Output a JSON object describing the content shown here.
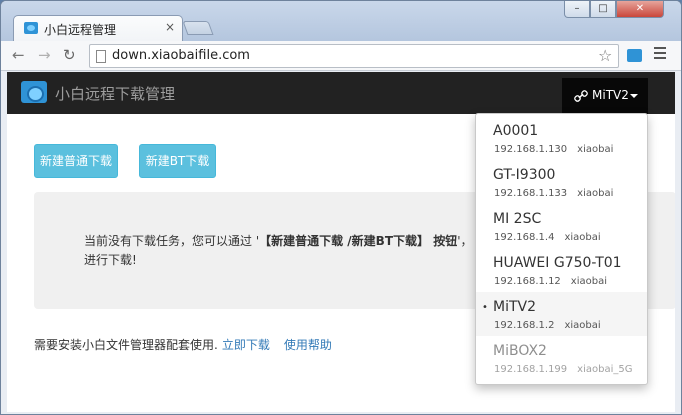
{
  "browser": {
    "tab_title": "小白远程管理",
    "tab_close": "×",
    "url": "down.xiaobaifile.com",
    "window_controls": {
      "minimize": "–",
      "maximize": "□",
      "close": "✕"
    }
  },
  "app": {
    "brand": "小白远程下载管理",
    "device_button": "MiTV2",
    "buttons": {
      "new_normal": "新建普通下载",
      "new_bt": "新建BT下载"
    },
    "message_part1": "当前没有下载任务，您可以通过 '",
    "message_bold": "【新建普通下载 /新建BT下载】 按钮",
    "message_part2": "'，",
    "message_line2": "进行下载!",
    "footer_text": "需要安装小白文件管理器配套使用.",
    "footer_link_download": "立即下载",
    "footer_link_help": "使用帮助"
  },
  "devices": [
    {
      "name": "A0001",
      "ip": "192.168.1.130",
      "user": "xiaobai"
    },
    {
      "name": "GT-I9300",
      "ip": "192.168.1.133",
      "user": "xiaobai"
    },
    {
      "name": "MI 2SC",
      "ip": "192.168.1.4",
      "user": "xiaobai"
    },
    {
      "name": "HUAWEI G750-T01",
      "ip": "192.168.1.12",
      "user": "xiaobai"
    },
    {
      "name": "MiTV2",
      "ip": "192.168.1.2",
      "user": "xiaobai",
      "selected": true,
      "marker": "•"
    },
    {
      "name": "MiBOX2",
      "ip": "192.168.1.199",
      "user": "xiaobai_5G"
    }
  ],
  "colors": {
    "navbar": "#222222",
    "button_info": "#5bc0de",
    "link": "#337ab7"
  }
}
